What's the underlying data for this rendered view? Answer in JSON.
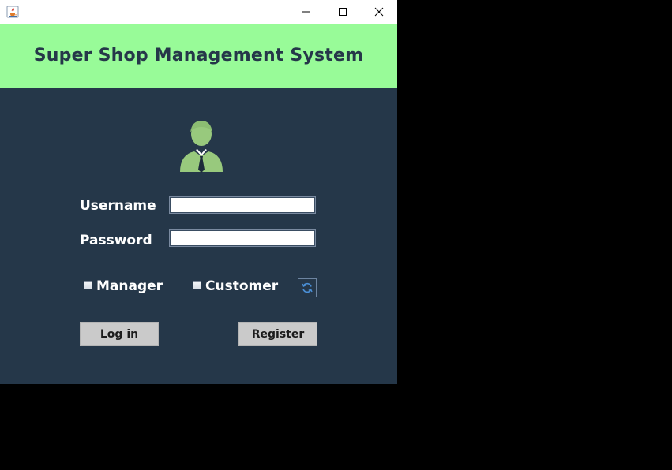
{
  "titlebar": {
    "app_icon": "java-cup-icon",
    "controls": [
      "minimize-icon",
      "maximize-icon",
      "close-icon"
    ]
  },
  "header": {
    "title": "Super Shop Management System"
  },
  "form": {
    "avatar_icon": "user-avatar-icon",
    "username_label": "Username",
    "username_value": "",
    "password_label": "Password",
    "password_value": "",
    "manager_label": "Manager",
    "manager_checked": false,
    "customer_label": "Customer",
    "customer_checked": false,
    "refresh_icon": "refresh-icon",
    "login_label": "Log in",
    "register_label": "Register"
  },
  "colors": {
    "header_bg": "#98fb98",
    "panel_bg": "#253749",
    "avatar": "#98c97d",
    "button_bg": "#cacaca"
  }
}
